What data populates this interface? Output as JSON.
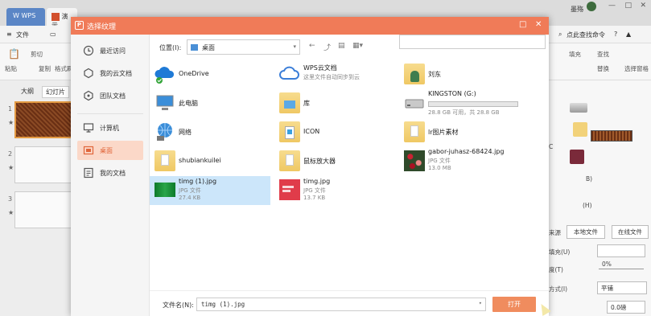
{
  "app": {
    "tabs": [
      {
        "label": "WPS"
      },
      {
        "label": "演示"
      }
    ],
    "user_name": "墨殇",
    "menu": {
      "file": "文件"
    },
    "ribbon": {
      "paste": "粘贴",
      "cut": "剪切",
      "copy": "复制",
      "format_painter": "格式刷",
      "fill": "填充",
      "find": "查找",
      "replace": "替换",
      "selection_pane": "选择窗格",
      "search_cmd": "点此查找命令"
    },
    "left_pane": {
      "tab_outline": "大纲",
      "tab_slides": "幻灯片",
      "slides": [
        "1",
        "2",
        "3"
      ],
      "star": "★"
    },
    "right_pane": {
      "label_c": "C",
      "label_b": "B)",
      "label_h": "(H)",
      "source": "来源",
      "local_file": "本地文件",
      "online_file": "在线文件",
      "fill_u": "填充(U)",
      "transparency": "度(T)",
      "transparency_value": "0%",
      "mode": "方式(I)",
      "mode_value": "平铺",
      "offset_value": "0.0磅"
    }
  },
  "dialog": {
    "title": "选择纹理",
    "sidebar": [
      {
        "label": "最近访问",
        "icon": "clock-icon"
      },
      {
        "label": "我的云文档",
        "icon": "cloud-doc-icon"
      },
      {
        "label": "团队文档",
        "icon": "team-icon"
      },
      {
        "label": "计算机",
        "icon": "computer-icon"
      },
      {
        "label": "桌面",
        "icon": "desktop-icon",
        "active": true
      },
      {
        "label": "我的文档",
        "icon": "documents-icon"
      }
    ],
    "location": {
      "label": "位置(I):",
      "value": "桌面"
    },
    "files": [
      {
        "name": "OneDrive",
        "icon": "onedrive-icon"
      },
      {
        "name": "WPS云文档",
        "sub": "这里文件自动同步到云",
        "icon": "wps-cloud-icon"
      },
      {
        "name": "刘东",
        "icon": "user-folder-icon"
      },
      {
        "name": "此电脑",
        "icon": "pc-icon"
      },
      {
        "name": "库",
        "icon": "library-icon"
      },
      {
        "name": "KINGSTON (G:)",
        "sub": "28.8 GB 可用，共 28.8 GB",
        "icon": "usb-drive-icon",
        "usage": 0.0
      },
      {
        "name": "网络",
        "icon": "network-icon"
      },
      {
        "name": "ICON",
        "icon": "icon-folder-icon"
      },
      {
        "name": "lr图片素材",
        "icon": "folder-icon"
      },
      {
        "name": "shubiankuilei",
        "icon": "folder-icon"
      },
      {
        "name": "鼠标放大器",
        "icon": "folder-icon"
      },
      {
        "name": "gabor-juhasz-68424.jpg",
        "type": "JPG 文件",
        "size": "13.0 MB",
        "icon": "image-icon"
      },
      {
        "name": "timg (1).jpg",
        "type": "JPG 文件",
        "size": "27.4 KB",
        "icon": "image-icon",
        "selected": true
      },
      {
        "name": "timg.jpg",
        "type": "JPG 文件",
        "size": "13.7 KB",
        "icon": "image-icon"
      }
    ],
    "filename_label": "文件名(N):",
    "filename_value": "timg (1).jpg",
    "open_button": "打开"
  }
}
